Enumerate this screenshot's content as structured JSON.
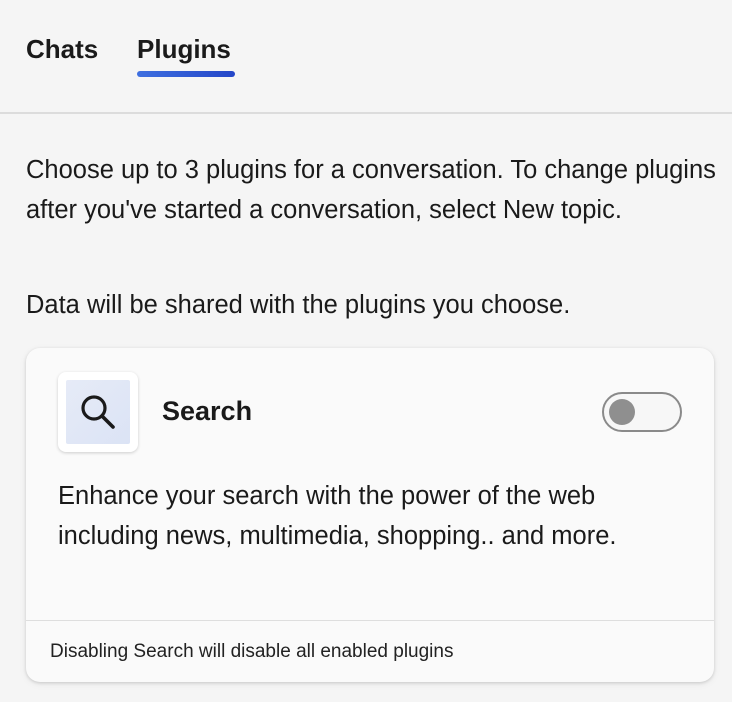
{
  "tabs": {
    "chats_label": "Chats",
    "plugins_label": "Plugins",
    "active": "Plugins",
    "accent_color": "#2f55d4"
  },
  "intro": {
    "text": "Choose up to 3 plugins for a conversation. To change plugins after you've started a conversation, select New topic.",
    "note": "Data will be shared with the plugins you choose."
  },
  "plugin": {
    "icon": "search-icon",
    "name": "Search",
    "enabled": false,
    "description": "Enhance your search with the power of the web including news, multimedia, shopping.. and more.",
    "footer": "Disabling Search will disable all enabled plugins"
  }
}
